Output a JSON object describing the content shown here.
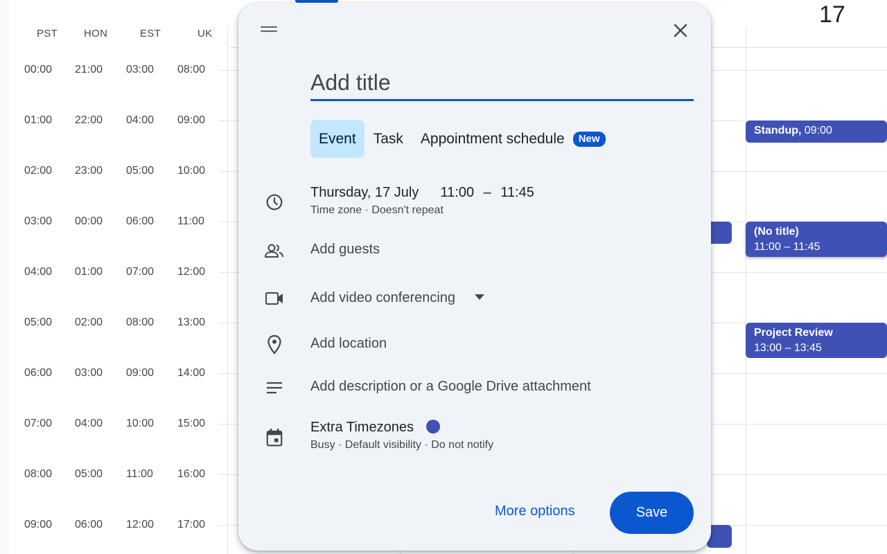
{
  "timezones": {
    "labels": [
      "PST",
      "HON",
      "EST",
      "UK"
    ],
    "rows": [
      [
        "00:00",
        "21:00",
        "03:00",
        "08:00"
      ],
      [
        "01:00",
        "22:00",
        "04:00",
        "09:00"
      ],
      [
        "02:00",
        "23:00",
        "05:00",
        "10:00"
      ],
      [
        "03:00",
        "00:00",
        "06:00",
        "11:00"
      ],
      [
        "04:00",
        "01:00",
        "07:00",
        "12:00"
      ],
      [
        "05:00",
        "02:00",
        "08:00",
        "13:00"
      ],
      [
        "06:00",
        "03:00",
        "09:00",
        "14:00"
      ],
      [
        "07:00",
        "04:00",
        "10:00",
        "15:00"
      ],
      [
        "08:00",
        "05:00",
        "11:00",
        "16:00"
      ],
      [
        "09:00",
        "06:00",
        "12:00",
        "17:00"
      ]
    ]
  },
  "calendar": {
    "date_number": "17"
  },
  "events": [
    {
      "title": "Standup,",
      "time": "09:00"
    },
    {
      "title": "(No title)",
      "time": "11:00 – 11:45"
    },
    {
      "title": "Project Review",
      "time": "13:00 – 13:45"
    }
  ],
  "dialog": {
    "title_placeholder": "Add title",
    "tabs": [
      {
        "label": "Event",
        "active": true
      },
      {
        "label": "Task",
        "active": false
      },
      {
        "label": "Appointment schedule",
        "active": false,
        "badge": "New"
      }
    ],
    "datetime": {
      "date": "Thursday, 17 July",
      "start": "11:00",
      "separator": "–",
      "end": "11:45",
      "sub": "Time zone · Doesn't repeat"
    },
    "guests_label": "Add guests",
    "video_label": "Add video conferencing",
    "location_label": "Add location",
    "description_label": "Add description or a Google Drive attachment",
    "calendar": {
      "name": "Extra Timezones",
      "color": "#3f51b5",
      "sub": "Busy · Default visibility · Do not notify"
    },
    "more_options_label": "More options",
    "save_label": "Save"
  },
  "colors": {
    "accent": "#0b57d0",
    "event": "#3f51b5",
    "dialog_bg": "#f0f4f9",
    "tab_active_bg": "#c2e7ff"
  }
}
